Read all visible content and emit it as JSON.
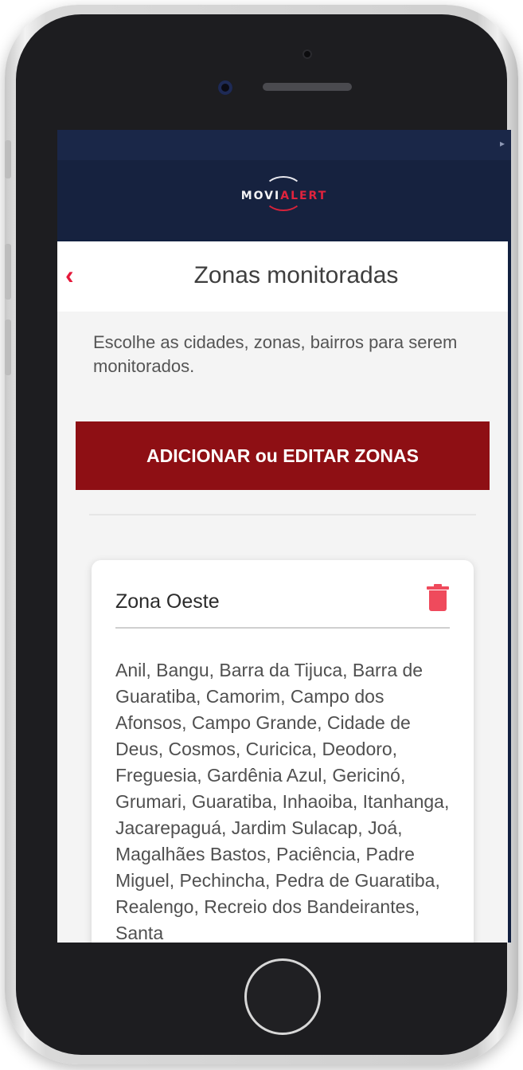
{
  "logo": {
    "part1": "MOVI",
    "part2": "ALERT"
  },
  "nav": {
    "back_icon": "chevron-left-icon",
    "title": "Zonas monitoradas"
  },
  "description": "Escolhe as cidades, zonas, bairros para serem monitorados.",
  "add_button_label": "ADICIONAR ou EDITAR ZONAS",
  "zone_card": {
    "title": "Zona Oeste",
    "delete_icon": "trash-icon",
    "neighborhoods": "Anil, Bangu, Barra da Tijuca, Barra de Guaratiba, Camorim, Campo dos Afonsos, Campo Grande, Cidade de Deus, Cosmos, Curicica, Deodoro, Freguesia, Gardênia Azul, Gericinó, Grumari, Guaratiba, Inhaoiba, Itanhanga, Jacarepaguá, Jardim Sulacap, Joá, Magalhães Bastos, Paciência, Padre Miguel, Pechincha, Pedra de Guaratiba, Realengo, Recreio dos Bandeirantes, Santa"
  },
  "colors": {
    "header_bg": "#16223f",
    "accent_red": "#e1233d",
    "button_bg": "#8e0f14",
    "trash_icon": "#ef4a5c",
    "content_bg": "#f4f4f4"
  }
}
